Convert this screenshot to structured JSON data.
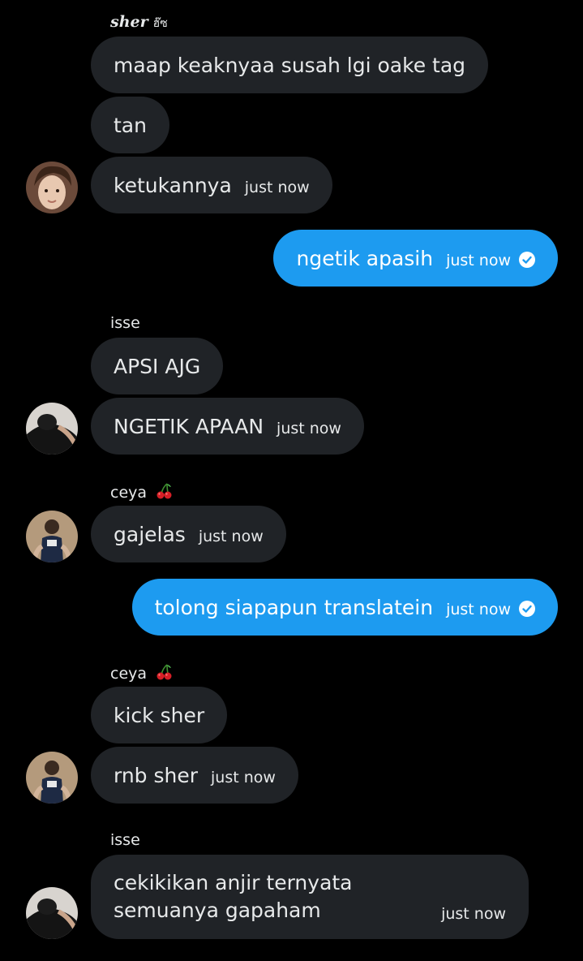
{
  "colors": {
    "background": "#000000",
    "incoming_bubble": "#202327",
    "outgoing_bubble": "#1d9bf0",
    "text": "#e7e9ea"
  },
  "groups": [
    {
      "sender": "sher",
      "sender_suffix": "ฮ๊ซ",
      "messages": [
        "maap keaknyaa susah lgi oake tag",
        "tan",
        "ketukannya"
      ],
      "time": "just now"
    },
    {
      "outgoing": true,
      "messages": [
        "ngetik apasih"
      ],
      "time": "just now",
      "status_icon": "read-check-icon"
    },
    {
      "sender": "isse",
      "messages": [
        "APSI AJG",
        "NGETIK APAAN"
      ],
      "time": "just now"
    },
    {
      "sender": "ceya",
      "sender_icon": "cherry-icon",
      "messages": [
        "gajelas"
      ],
      "time": "just now"
    },
    {
      "outgoing": true,
      "messages": [
        "tolong siapapun translatein"
      ],
      "time": "just now",
      "status_icon": "read-check-icon"
    },
    {
      "sender": "ceya",
      "sender_icon": "cherry-icon",
      "messages": [
        "kick sher",
        "rnb sher"
      ],
      "time": "just now"
    },
    {
      "sender": "isse",
      "messages": [
        "cekikikan anjir ternyata semuanya gapaham"
      ],
      "time": "just now"
    }
  ]
}
